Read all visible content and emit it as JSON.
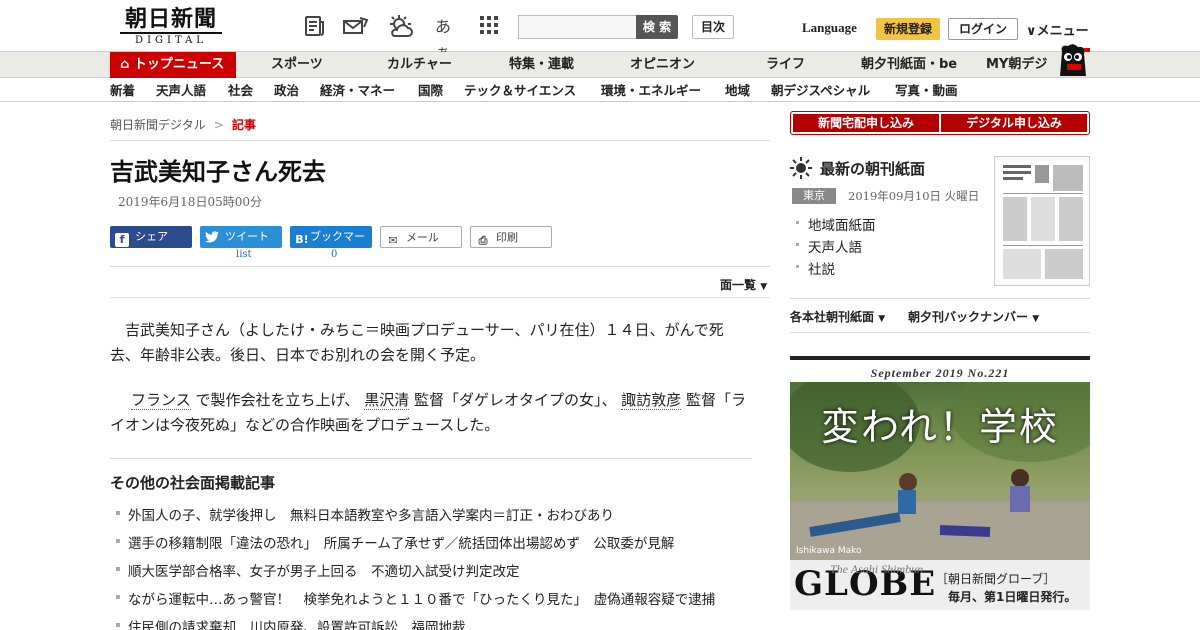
{
  "header": {
    "logo_line1": "朝日新聞",
    "logo_line2": "DIGITAL",
    "icon_fontsize_label": "あぁ",
    "search_placeholder": "",
    "search_button": "検 索",
    "toc_button": "目次",
    "language": "Language",
    "register": "新規登録",
    "login": "ログイン",
    "menu": "メニュー"
  },
  "nav_primary": [
    "トップニュース",
    "スポーツ",
    "カルチャー",
    "特集・連載",
    "オピニオン",
    "ライフ",
    "朝夕刊紙面・be",
    "MY朝デジ"
  ],
  "nav_secondary": [
    "新着",
    "天声人語",
    "社会",
    "政治",
    "経済・マネー",
    "国際",
    "テック＆サイエンス",
    "環境・エネルギー",
    "地域",
    "朝デジスペシャル",
    "写真・動画"
  ],
  "breadcrumb": {
    "home": "朝日新聞デジタル",
    "sep": ">",
    "current": "記事"
  },
  "article": {
    "title": "吉武美知子さん死去",
    "date": "2019年6月18日05時00分",
    "share": {
      "facebook": "シェア",
      "twitter": "ツイート",
      "twitter_count": "list",
      "hatena": "ブックマーク",
      "hatena_count": "0",
      "mail": "メール",
      "print": "印刷"
    },
    "page_list": "面一覧",
    "p1": "吉武美知子さん（よしたけ・みちこ＝映画プロデューサー、パリ在住）１４日、がんで死去、年齢非公表。後日、日本でお別れの会を開く予定。",
    "p2_a": "フランス",
    "p2_b": " で製作会社を立ち上げ、 ",
    "p2_c": "黒沢清",
    "p2_d": " 監督「ダゲレオタイプの女」、 ",
    "p2_e": "諏訪敦彦",
    "p2_f": " 監督「ライオンは今夜死ぬ」などの合作映画をプロデュースした。"
  },
  "others": {
    "title": "その他の社会面掲載記事",
    "items": [
      "外国人の子、就学後押し　無料日本語教室や多言語入学案内＝訂正・おわびあり",
      "選手の移籍制限「違法の恐れ」　所属チーム了承せず／統括団体出場認めず　公取委が見解",
      "順大医学部合格率、女子が男子上回る　不適切入試受け判定改定",
      "ながら運転中…あっ警官！　検挙免れようと１１０番で「ひったくり見た」　虚偽通報容疑で逮捕",
      "住民側の請求棄却　川内原発、設置許可訴訟　福岡地裁"
    ]
  },
  "sidebar": {
    "subscribe_paper": "新聞宅配申し込み",
    "subscribe_digital": "デジタル申し込み",
    "latest_title": "最新の朝刊紙面",
    "region": "東京",
    "paper_date": "2019年09月10日 火曜日",
    "links": [
      "地域面紙面",
      "天声人語",
      "社説"
    ],
    "dropdown1": "各本社朝刊紙面",
    "dropdown2": "朝夕刊バックナンバー",
    "globe_issue": "September  2019  No.221",
    "globe_headline": "変われ！学校",
    "globe_credit": "Ishikawa Mako",
    "globe_logo": "GLOBE",
    "globe_logo_sub": "The Asahi Shimbun",
    "globe_pub1": "［朝日新聞グローブ］",
    "globe_pub2": "毎月、第1日曜日発行。"
  },
  "colors": {
    "brand_red": "#c00000",
    "register_yellow": "#f5c342",
    "facebook": "#2b4c8c",
    "twitter": "#2a8fd6",
    "hatena": "#1a7fd1"
  }
}
